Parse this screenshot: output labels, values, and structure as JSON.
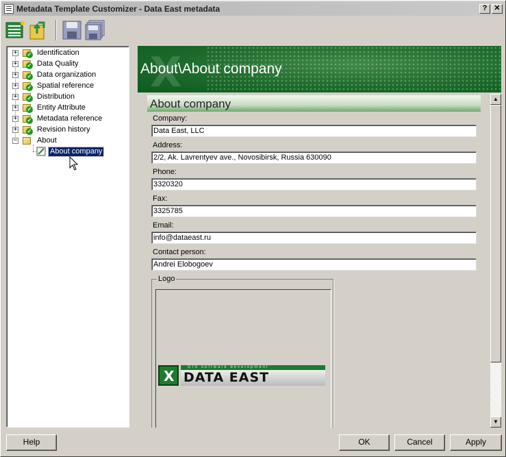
{
  "window": {
    "title": "Metadata Template Customizer - Data East metadata",
    "help_glyph": "?",
    "close_glyph": "✕"
  },
  "toolbar": {
    "items": [
      {
        "icon": "list-icon"
      },
      {
        "icon": "open-folder-icon"
      },
      {
        "icon": "save-icon"
      },
      {
        "icon": "save-all-icon"
      }
    ]
  },
  "tree": {
    "items": [
      {
        "label": "Identification",
        "expander": "+"
      },
      {
        "label": "Data Quality",
        "expander": "+"
      },
      {
        "label": "Data organization",
        "expander": "+"
      },
      {
        "label": "Spatial reference",
        "expander": "+"
      },
      {
        "label": "Distribution",
        "expander": "+"
      },
      {
        "label": "Entity Attribute",
        "expander": "+"
      },
      {
        "label": "Metadata reference",
        "expander": "+"
      },
      {
        "label": "Revision history",
        "expander": "+"
      },
      {
        "label": "About",
        "expander": "−"
      }
    ],
    "child": {
      "label": "About company",
      "selected": true
    }
  },
  "banner": {
    "title": "About\\About company"
  },
  "section": {
    "title": "About company"
  },
  "fields": {
    "company": {
      "label": "Company:",
      "value": "Data East, LLC"
    },
    "address": {
      "label": "Address:",
      "value": "2/2, Ak. Lavrentyev ave., Novosibirsk, Russia 630090"
    },
    "phone": {
      "label": "Phone:",
      "value": "3320320"
    },
    "fax": {
      "label": "Fax:",
      "value": "3325785"
    },
    "email": {
      "label": "Email:",
      "value": "info@dataeast.ru"
    },
    "contact": {
      "label": "Contact person:",
      "value": "Andrei Elobogoev"
    }
  },
  "logo": {
    "legend": "Logo",
    "strip_text": "GIS software development",
    "name": "DATA EAST"
  },
  "buttons": {
    "help": "Help",
    "ok": "OK",
    "cancel": "Cancel",
    "apply": "Apply"
  },
  "colors": {
    "selection": "#0a246a",
    "banner_green": "#1e6b2c",
    "face": "#d4d0c8"
  }
}
